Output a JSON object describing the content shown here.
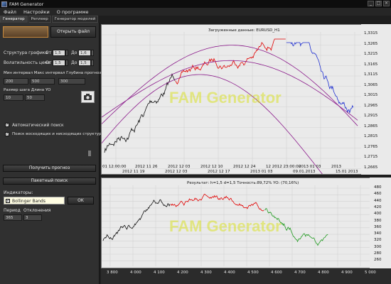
{
  "window": {
    "title": "FAM Generator",
    "controls": [
      "_",
      "□",
      "×"
    ]
  },
  "menu": [
    "Файл",
    "Настройки",
    "О программе"
  ],
  "tabs": [
    {
      "label": "Генератор",
      "active": true
    },
    {
      "label": "Реплеер",
      "active": false
    },
    {
      "label": "Генератор моделей",
      "active": false
    }
  ],
  "left_panel": {
    "open_file_button": "Открыть файл",
    "structure_label": "Структура графика",
    "structure_from_label": "От",
    "structure_from": "1,5",
    "structure_to_label": "До",
    "structure_to": "1,6",
    "volatility_label": "Волатильность цене",
    "volatility_from_label": "От",
    "volatility_from": "1,5",
    "volatility_to_label": "До",
    "volatility_to": "1,5",
    "interval_labels": "Мин интервал Макс интервал Глубина прогноза",
    "min_interval": "200",
    "max_interval": "500",
    "forecast_depth": "300",
    "step_label": "Размер шага Длина YO",
    "step": "10",
    "yo_length": "50",
    "auto_search_label": "Автоматический поиск",
    "auto_search_checked": true,
    "trend_search_label": "Поиск восходящих и нисходящих структур",
    "trend_search_checked": true,
    "get_forecast_button": "Получить прогноз",
    "batch_search_button": "Пакетный поиск",
    "indicators_label": "Индикаторы:",
    "indicator_selected": "Bollinger Bands",
    "indicator_checked": true,
    "ok_button": "OK",
    "period_label": "Период",
    "deviation_label": "Отклонения",
    "period": "365",
    "deviation": "3"
  },
  "watermark": "FAM Generator",
  "top_chart": {
    "title": "Загруженные данные: EURUSD_H1",
    "y_ticks": [
      "1,3315",
      "1,3265",
      "1,3215",
      "1,3165",
      "1,3115",
      "1,3065",
      "1,3015",
      "1,2965",
      "1,2915",
      "1,2865",
      "1,2815",
      "1,2765",
      "1,2715",
      "1,2665"
    ],
    "x_ticks_upper": [
      "01 12:00:00",
      "2012 11 26",
      "2012 12 03",
      "2012 12 10",
      "2012 12 24",
      "12 2012 23:00:00",
      "2013 01 03",
      "2013"
    ],
    "x_ticks_lower": [
      "2012 11 19",
      "2012 12 03",
      "2012 12 17",
      "2013 01 03",
      "09.01.2013",
      "15.01 2013"
    ]
  },
  "bottom_chart": {
    "title": "Результат: h=1,5  d=1,5   Точность:89,72%  YO: (70,16%)",
    "y_ticks": [
      "480",
      "460",
      "440",
      "420",
      "400",
      "380",
      "360",
      "340",
      "320",
      "300",
      "280",
      "260"
    ],
    "x_ticks": [
      "3 800",
      "4 000",
      "4 100",
      "4 200",
      "4 300",
      "4 400",
      "4 500",
      "4 600",
      "4 700",
      "4 800",
      "4 900",
      "5 000"
    ]
  },
  "colors": {
    "history": "#111111",
    "forecast": "#e00000",
    "actual": "#1f2fd0",
    "bands": "#8b1a8b",
    "result_history": "#111111",
    "result_red": "#e00000",
    "result_green": "#1e9a1e",
    "plot_bg": "#eaeaea",
    "watermark": "#d8e000"
  }
}
